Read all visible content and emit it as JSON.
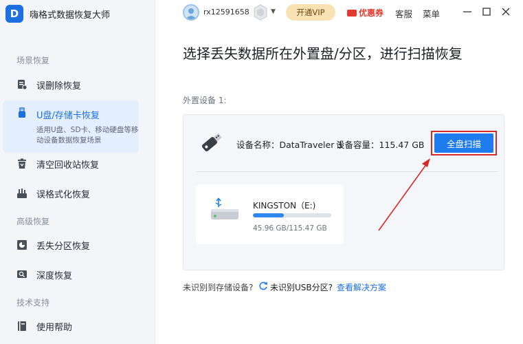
{
  "app": {
    "title": "嗨格式数据恢复大师",
    "logo_letter": "D"
  },
  "sidebar": {
    "sections": [
      {
        "label": "场景恢复"
      },
      {
        "label": "高级恢复"
      },
      {
        "label": "技术支持"
      }
    ],
    "items": [
      {
        "label": "误删除恢复",
        "icon": "trash-restore-icon"
      },
      {
        "label": "U盘/存储卡恢复",
        "icon": "usb-icon",
        "desc": "适用U盘、SD卡、移动硬盘等移动设备数据恢复场景",
        "active": true
      },
      {
        "label": "清空回收站恢复",
        "icon": "recycle-bin-icon"
      },
      {
        "label": "误格式化恢复",
        "icon": "format-icon"
      },
      {
        "label": "丢失分区恢复",
        "icon": "partition-icon"
      },
      {
        "label": "深度恢复",
        "icon": "deep-scan-icon"
      },
      {
        "label": "使用帮助",
        "icon": "help-book-icon"
      }
    ]
  },
  "topbar": {
    "username": "rx12591658",
    "vip_button": "开通VIP",
    "coupon": "优惠券",
    "service": "客服",
    "menu": "菜单"
  },
  "main": {
    "title": "选择丢失数据所在外置盘/分区，进行扫描恢复",
    "device_count_label": "外置设备 1:",
    "device": {
      "name": "设备名称：DataTraveler 3",
      "capacity": "设备容量：115.47 GB",
      "scan_button": "全盘扫描"
    },
    "partition": {
      "name": "KINGSTON（E:)",
      "size": "45.96 GB/115.47 GB",
      "used_fraction": 0.398
    },
    "footer": {
      "q1": "未识别到存储设备?",
      "q2": "未识别USB分区?",
      "link": "查看解决方案"
    }
  },
  "colors": {
    "accent": "#1e7cf0",
    "highlight": "#d62a2a",
    "vip": "#f8e2b4",
    "coupon": "#e23b2e"
  }
}
